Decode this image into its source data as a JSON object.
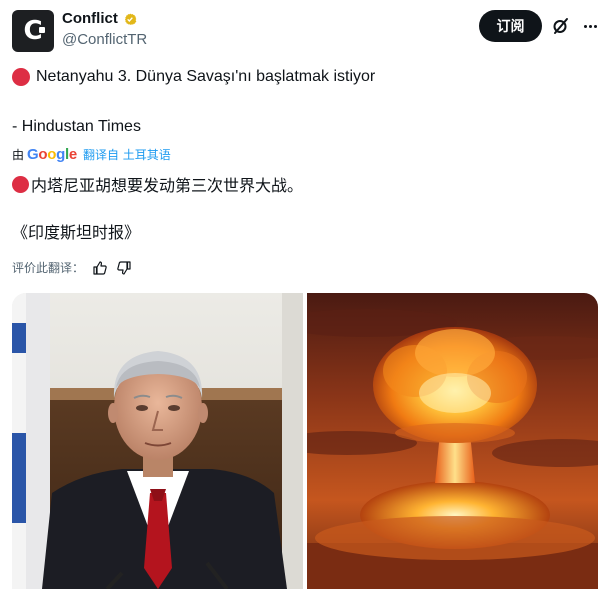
{
  "author": {
    "display_name": "Conflict",
    "handle": "@ConflictTR",
    "avatar_letter": "C",
    "verified_color": "#e2b719"
  },
  "actions": {
    "subscribe_label": "订阅"
  },
  "tweet": {
    "original_line1": "Netanyahu 3. Dünya Savaşı'nı başlatmak istiyor",
    "original_line2": "- Hindustan Times",
    "translated_by_prefix": "由",
    "translated_by_brand": [
      "G",
      "o",
      "o",
      "g",
      "l",
      "e"
    ],
    "translate_link": "翻译自 土耳其语",
    "translated_line1": "内塔尼亚胡想要发动第三次世界大战。",
    "translated_line2": "《印度斯坦时报》"
  },
  "rate": {
    "label": "评价此翻译："
  },
  "colors": {
    "red_circle": "#dd2e44",
    "link": "#1d9bf0",
    "secondary_text": "#536471"
  }
}
